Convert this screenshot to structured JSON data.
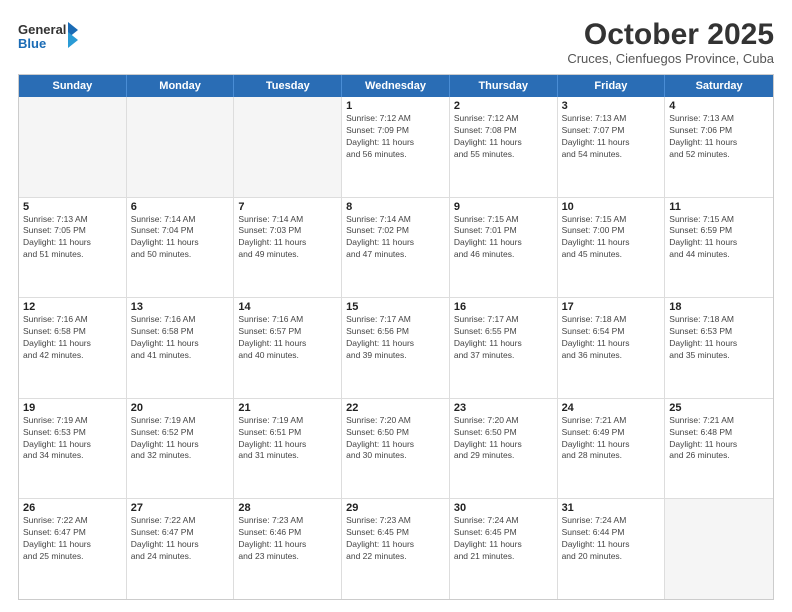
{
  "logo": {
    "line1": "General",
    "line2": "Blue"
  },
  "title": "October 2025",
  "subtitle": "Cruces, Cienfuegos Province, Cuba",
  "weekdays": [
    "Sunday",
    "Monday",
    "Tuesday",
    "Wednesday",
    "Thursday",
    "Friday",
    "Saturday"
  ],
  "weeks": [
    [
      {
        "day": "",
        "info": ""
      },
      {
        "day": "",
        "info": ""
      },
      {
        "day": "",
        "info": ""
      },
      {
        "day": "1",
        "info": "Sunrise: 7:12 AM\nSunset: 7:09 PM\nDaylight: 11 hours\nand 56 minutes."
      },
      {
        "day": "2",
        "info": "Sunrise: 7:12 AM\nSunset: 7:08 PM\nDaylight: 11 hours\nand 55 minutes."
      },
      {
        "day": "3",
        "info": "Sunrise: 7:13 AM\nSunset: 7:07 PM\nDaylight: 11 hours\nand 54 minutes."
      },
      {
        "day": "4",
        "info": "Sunrise: 7:13 AM\nSunset: 7:06 PM\nDaylight: 11 hours\nand 52 minutes."
      }
    ],
    [
      {
        "day": "5",
        "info": "Sunrise: 7:13 AM\nSunset: 7:05 PM\nDaylight: 11 hours\nand 51 minutes."
      },
      {
        "day": "6",
        "info": "Sunrise: 7:14 AM\nSunset: 7:04 PM\nDaylight: 11 hours\nand 50 minutes."
      },
      {
        "day": "7",
        "info": "Sunrise: 7:14 AM\nSunset: 7:03 PM\nDaylight: 11 hours\nand 49 minutes."
      },
      {
        "day": "8",
        "info": "Sunrise: 7:14 AM\nSunset: 7:02 PM\nDaylight: 11 hours\nand 47 minutes."
      },
      {
        "day": "9",
        "info": "Sunrise: 7:15 AM\nSunset: 7:01 PM\nDaylight: 11 hours\nand 46 minutes."
      },
      {
        "day": "10",
        "info": "Sunrise: 7:15 AM\nSunset: 7:00 PM\nDaylight: 11 hours\nand 45 minutes."
      },
      {
        "day": "11",
        "info": "Sunrise: 7:15 AM\nSunset: 6:59 PM\nDaylight: 11 hours\nand 44 minutes."
      }
    ],
    [
      {
        "day": "12",
        "info": "Sunrise: 7:16 AM\nSunset: 6:58 PM\nDaylight: 11 hours\nand 42 minutes."
      },
      {
        "day": "13",
        "info": "Sunrise: 7:16 AM\nSunset: 6:58 PM\nDaylight: 11 hours\nand 41 minutes."
      },
      {
        "day": "14",
        "info": "Sunrise: 7:16 AM\nSunset: 6:57 PM\nDaylight: 11 hours\nand 40 minutes."
      },
      {
        "day": "15",
        "info": "Sunrise: 7:17 AM\nSunset: 6:56 PM\nDaylight: 11 hours\nand 39 minutes."
      },
      {
        "day": "16",
        "info": "Sunrise: 7:17 AM\nSunset: 6:55 PM\nDaylight: 11 hours\nand 37 minutes."
      },
      {
        "day": "17",
        "info": "Sunrise: 7:18 AM\nSunset: 6:54 PM\nDaylight: 11 hours\nand 36 minutes."
      },
      {
        "day": "18",
        "info": "Sunrise: 7:18 AM\nSunset: 6:53 PM\nDaylight: 11 hours\nand 35 minutes."
      }
    ],
    [
      {
        "day": "19",
        "info": "Sunrise: 7:19 AM\nSunset: 6:53 PM\nDaylight: 11 hours\nand 34 minutes."
      },
      {
        "day": "20",
        "info": "Sunrise: 7:19 AM\nSunset: 6:52 PM\nDaylight: 11 hours\nand 32 minutes."
      },
      {
        "day": "21",
        "info": "Sunrise: 7:19 AM\nSunset: 6:51 PM\nDaylight: 11 hours\nand 31 minutes."
      },
      {
        "day": "22",
        "info": "Sunrise: 7:20 AM\nSunset: 6:50 PM\nDaylight: 11 hours\nand 30 minutes."
      },
      {
        "day": "23",
        "info": "Sunrise: 7:20 AM\nSunset: 6:50 PM\nDaylight: 11 hours\nand 29 minutes."
      },
      {
        "day": "24",
        "info": "Sunrise: 7:21 AM\nSunset: 6:49 PM\nDaylight: 11 hours\nand 28 minutes."
      },
      {
        "day": "25",
        "info": "Sunrise: 7:21 AM\nSunset: 6:48 PM\nDaylight: 11 hours\nand 26 minutes."
      }
    ],
    [
      {
        "day": "26",
        "info": "Sunrise: 7:22 AM\nSunset: 6:47 PM\nDaylight: 11 hours\nand 25 minutes."
      },
      {
        "day": "27",
        "info": "Sunrise: 7:22 AM\nSunset: 6:47 PM\nDaylight: 11 hours\nand 24 minutes."
      },
      {
        "day": "28",
        "info": "Sunrise: 7:23 AM\nSunset: 6:46 PM\nDaylight: 11 hours\nand 23 minutes."
      },
      {
        "day": "29",
        "info": "Sunrise: 7:23 AM\nSunset: 6:45 PM\nDaylight: 11 hours\nand 22 minutes."
      },
      {
        "day": "30",
        "info": "Sunrise: 7:24 AM\nSunset: 6:45 PM\nDaylight: 11 hours\nand 21 minutes."
      },
      {
        "day": "31",
        "info": "Sunrise: 7:24 AM\nSunset: 6:44 PM\nDaylight: 11 hours\nand 20 minutes."
      },
      {
        "day": "",
        "info": ""
      }
    ]
  ]
}
